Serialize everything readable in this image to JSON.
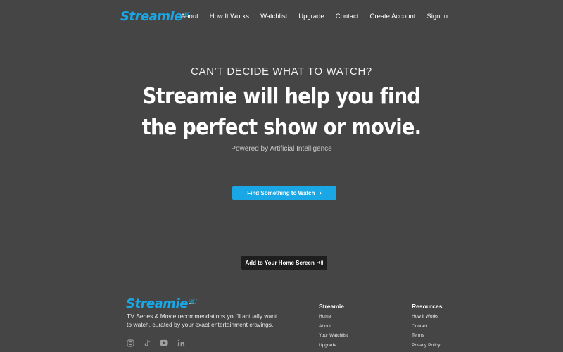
{
  "header": {
    "logo": "Streamie",
    "nav": [
      "About",
      "How It Works",
      "Watchlist",
      "Upgrade",
      "Contact",
      "Create Account",
      "Sign In"
    ]
  },
  "hero": {
    "eyebrow": "CAN'T DECIDE WHAT TO WATCH?",
    "headline_line1": "Streamie will help you find",
    "headline_line2": "the perfect show or movie.",
    "powered": "Powered by Artificial Intelligence",
    "cta_label": "Find Something to Watch",
    "home_label": "Add to Your Home Screen"
  },
  "footer": {
    "logo": "Streamie",
    "tagline": "TV Series & Movie recommendations you'll actually want to watch, curated by your exact entertainment cravings.",
    "social": [
      "instagram-icon",
      "tiktok-icon",
      "youtube-icon",
      "linkedin-icon"
    ],
    "col1": {
      "title": "Streamie",
      "links": [
        "Home",
        "About",
        "Your Watchlist",
        "Upgrade"
      ]
    },
    "col2": {
      "title": "Resources",
      "links": [
        "How it Works",
        "Contact",
        "Terms",
        "Privacy Policy"
      ]
    }
  },
  "colors": {
    "brand": "#1aa7e6",
    "background": "#454545"
  }
}
